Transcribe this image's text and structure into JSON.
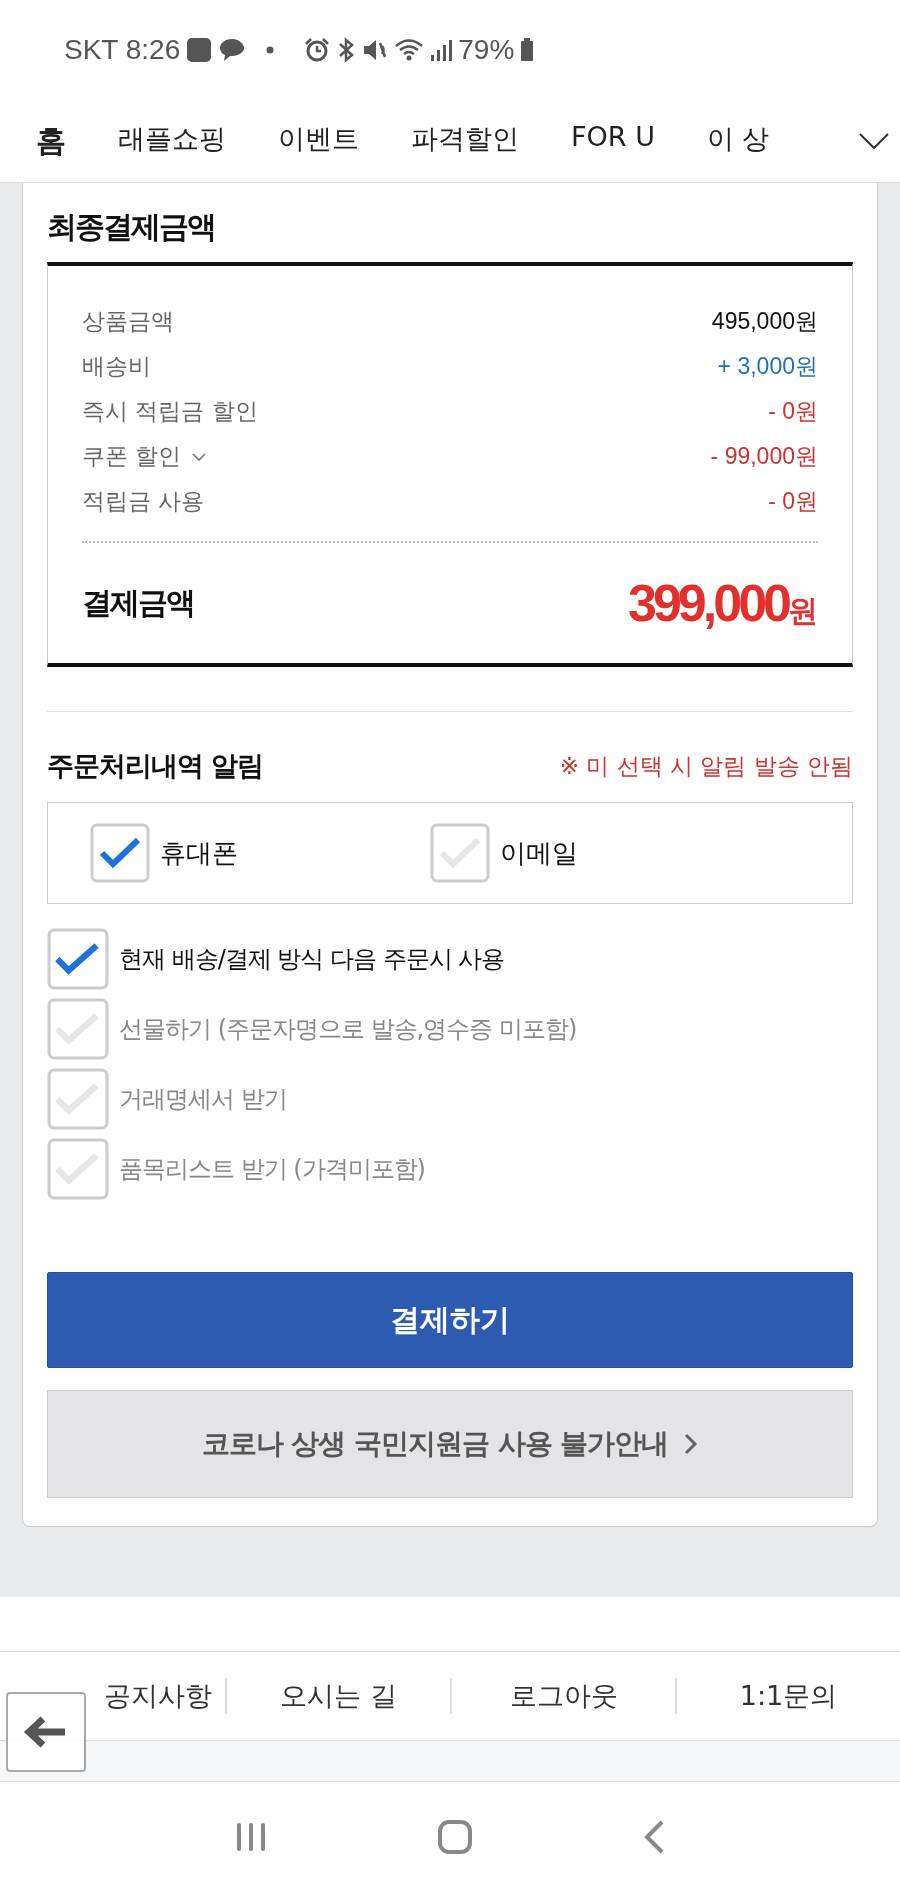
{
  "status_bar": {
    "carrier_time": "SKT 8:26",
    "battery": "79%"
  },
  "nav_tabs": [
    {
      "label": "홈",
      "selected": true
    },
    {
      "label": "래플쇼핑",
      "selected": false
    },
    {
      "label": "이벤트",
      "selected": false
    },
    {
      "label": "파격할인",
      "selected": false
    },
    {
      "label": "FOR U",
      "selected": false
    },
    {
      "label": "이 상",
      "selected": false
    }
  ],
  "summary": {
    "title": "최종결제금액",
    "rows": [
      {
        "label": "상품금액",
        "value": "495,000원",
        "kind": "normal",
        "has_dropdown": false
      },
      {
        "label": "배송비",
        "value": "+ 3,000원",
        "kind": "plus",
        "has_dropdown": false
      },
      {
        "label": "즉시 적립금 할인",
        "value": "- 0원",
        "kind": "minus",
        "has_dropdown": false
      },
      {
        "label": "쿠폰 할인",
        "value": "- 99,000원",
        "kind": "minus",
        "has_dropdown": true
      },
      {
        "label": "적립금 사용",
        "value": "- 0원",
        "kind": "minus",
        "has_dropdown": false
      }
    ],
    "total_label": "결제금액",
    "total_amount": "399,000",
    "total_unit": "원"
  },
  "notification": {
    "title": "주문처리내역 알림",
    "warning": "※ 미 선택 시 알림 발송 안됨",
    "channels": [
      {
        "label": "휴대폰",
        "checked": true
      },
      {
        "label": "이메일",
        "checked": false
      }
    ]
  },
  "options": [
    {
      "label": "현재 배송/결제 방식 다음 주문시 사용",
      "checked": true
    },
    {
      "label": "선물하기 (주문자명으로 발송,영수증 미포함)",
      "checked": false
    },
    {
      "label": "거래명세서 받기",
      "checked": false
    },
    {
      "label": "품목리스트 받기 (가격미포함)",
      "checked": false
    }
  ],
  "pay_button": "결제하기",
  "notice_button": "코로나 상생 국민지원금 사용 불가안내",
  "footer_links": [
    "공지사항",
    "오시는 길",
    "로그아웃",
    "1:1문의"
  ]
}
